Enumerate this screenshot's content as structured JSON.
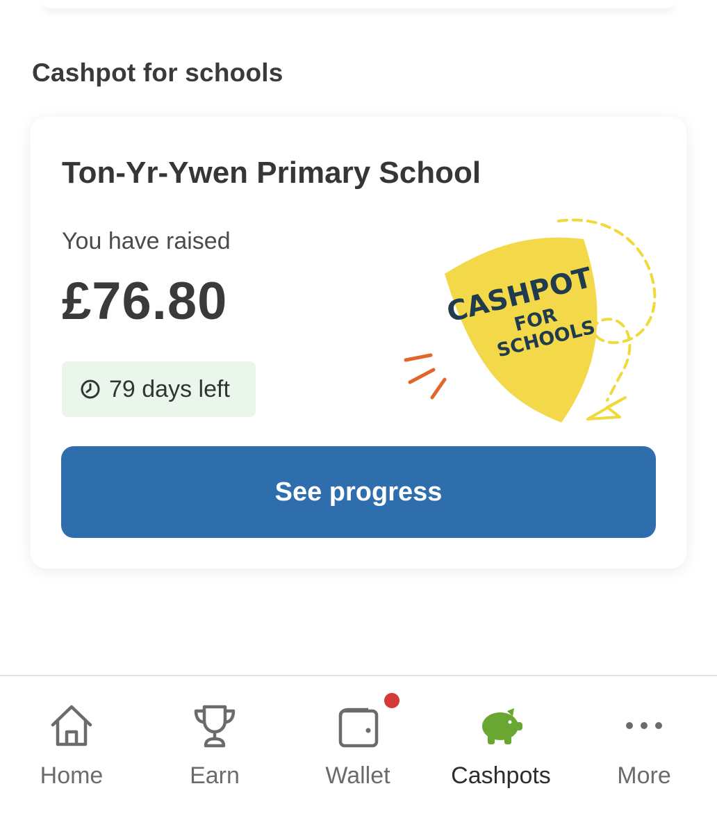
{
  "section": {
    "title": "Cashpot for schools"
  },
  "card": {
    "school_name": "Ton-Yr-Ywen Primary School",
    "raised_label": "You have raised",
    "raised_amount": "£76.80",
    "days_left": "79 days left",
    "cta_label": "See progress",
    "logo_text": {
      "line1": "CASHPOT",
      "line2": "FOR",
      "line3": "SCHOOLS"
    }
  },
  "tabbar": {
    "tabs": [
      {
        "label": "Home",
        "icon": "home-icon",
        "active": false
      },
      {
        "label": "Earn",
        "icon": "trophy-icon",
        "active": false
      },
      {
        "label": "Wallet",
        "icon": "wallet-icon",
        "active": false,
        "notification": true
      },
      {
        "label": "Cashpots",
        "icon": "piggy-bank-icon",
        "active": true
      },
      {
        "label": "More",
        "icon": "more-icon",
        "active": false
      }
    ]
  },
  "colors": {
    "primary_button": "#2f6ead",
    "badge_bg": "#eaf6ec",
    "logo_yellow": "#f3d94a",
    "logo_text": "#1f3b4d",
    "accent_orange": "#e0662a",
    "active_tab_icon": "#6aa632",
    "notification_dot": "#d33a36"
  }
}
